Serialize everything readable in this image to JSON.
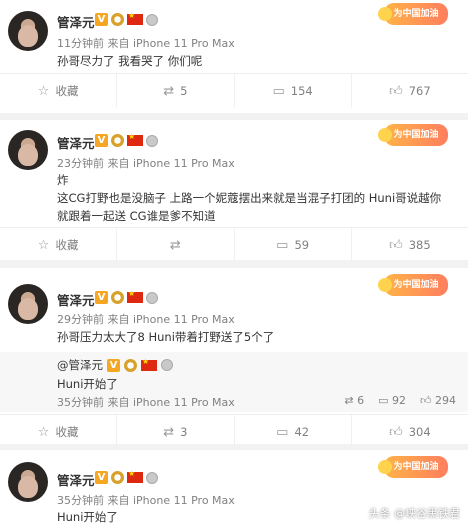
{
  "posts": [
    {
      "name": "管泽元",
      "meta": "11分钟前 来自 iPhone 11 Pro Max",
      "text": "孙哥尽力了 我看哭了 你们呢",
      "collect": "收藏",
      "repost": "5",
      "comment": "154",
      "like": "767"
    },
    {
      "name": "管泽元",
      "meta": "23分钟前 来自 iPhone 11 Pro Max",
      "text": "炸\n这CG打野也是没脑子 上路一个妮蔻摆出来就是当混子打团的 Huni哥说越你\n就跟着一起送 CG谁是爹不知道",
      "collect": "收藏",
      "repost": "",
      "comment": "59",
      "like": "385"
    },
    {
      "name": "管泽元",
      "meta": "29分钟前 来自 iPhone 11 Pro Max",
      "text": "孙哥压力太大了8 Huni带着打野送了5个了",
      "collect": "收藏",
      "repost": "3",
      "comment": "42",
      "like": "304",
      "quoted": {
        "name": "@管泽元",
        "text": "Huni开始了",
        "meta": "35分钟前 来自 iPhone 11 Pro Max",
        "repost": "6",
        "comment": "92",
        "like": "294"
      }
    },
    {
      "name": "管泽元",
      "meta": "35分钟前 来自 iPhone 11 Pro Max",
      "text": "Huni开始了"
    }
  ],
  "promo_label": "为中国加油",
  "watermark": "头条 @峡谷黑铁君",
  "icons": {
    "collect": "star-icon",
    "repost": "repost-icon",
    "comment": "comment-icon",
    "like": "thumb-up-icon"
  }
}
